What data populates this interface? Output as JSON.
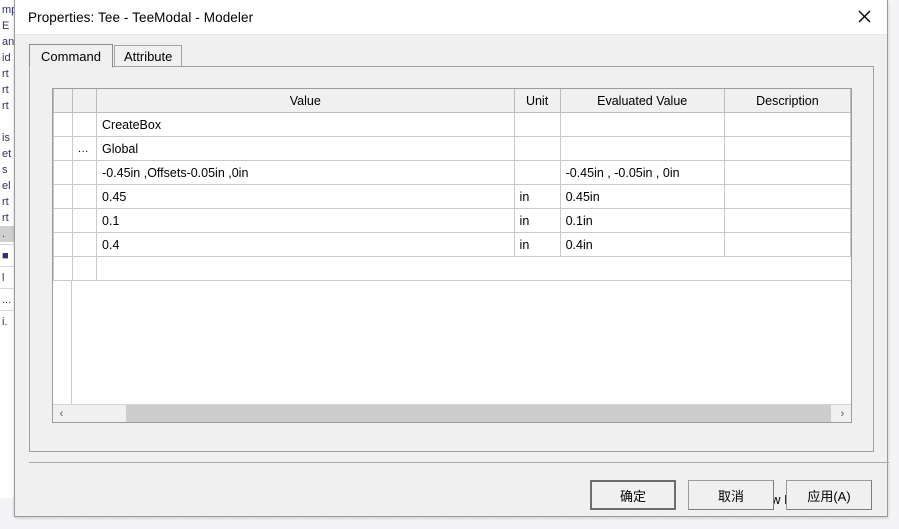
{
  "background": {
    "tree_fragments": [
      "mp",
      "E",
      "an",
      "id",
      "rt",
      "rt",
      "rt",
      "is",
      "et",
      "s",
      "el",
      "rt",
      "rt",
      ".",
      "■",
      "l",
      "...",
      "i."
    ]
  },
  "dialog": {
    "title": "Properties: Tee - TeeModal - Modeler",
    "close_icon": "close-icon",
    "tabs": [
      {
        "label": "Command",
        "active": true
      },
      {
        "label": "Attribute",
        "active": false
      }
    ],
    "grid": {
      "columns": [
        {
          "key": "rowhdr",
          "label": ""
        },
        {
          "key": "ellipsis",
          "label": ""
        },
        {
          "key": "value",
          "label": "Value"
        },
        {
          "key": "unit",
          "label": "Unit"
        },
        {
          "key": "evaluated",
          "label": "Evaluated Value"
        },
        {
          "key": "description",
          "label": "Description"
        }
      ],
      "rows": [
        {
          "ellipsis": "",
          "value": "CreateBox",
          "unit": "",
          "evaluated": "",
          "description": ""
        },
        {
          "ellipsis": "...",
          "value": "Global",
          "unit": "",
          "evaluated": "",
          "description": ""
        },
        {
          "ellipsis": "",
          "value": "-0.45in ,Offsets-0.05in ,0in",
          "unit": "",
          "evaluated": "-0.45in , -0.05in , 0in",
          "description": ""
        },
        {
          "ellipsis": "",
          "value": "0.45",
          "unit": "in",
          "evaluated": "0.45in",
          "description": ""
        },
        {
          "ellipsis": "",
          "value": "0.1",
          "unit": "in",
          "evaluated": "0.1in",
          "description": ""
        },
        {
          "ellipsis": "",
          "value": "0.4",
          "unit": "in",
          "evaluated": "0.4in",
          "description": ""
        }
      ],
      "hscroll": {
        "left_arrow": "‹",
        "right_arrow": "›"
      }
    },
    "show_hidden": {
      "label": "Show Hidden",
      "checked": false
    },
    "buttons": [
      {
        "label": "确定",
        "default": true,
        "mnemonic": ""
      },
      {
        "label": "取消",
        "default": false,
        "mnemonic": ""
      },
      {
        "label": "应用(A)",
        "default": false,
        "mnemonic": "A"
      }
    ]
  },
  "colors": {
    "dialog_bg": "#f0f0f0",
    "grid_bg": "#ffffff",
    "grid_header_bg": "#f0f0f0",
    "border": "#9a9a9a",
    "scroll_thumb": "#cdcdcd"
  }
}
